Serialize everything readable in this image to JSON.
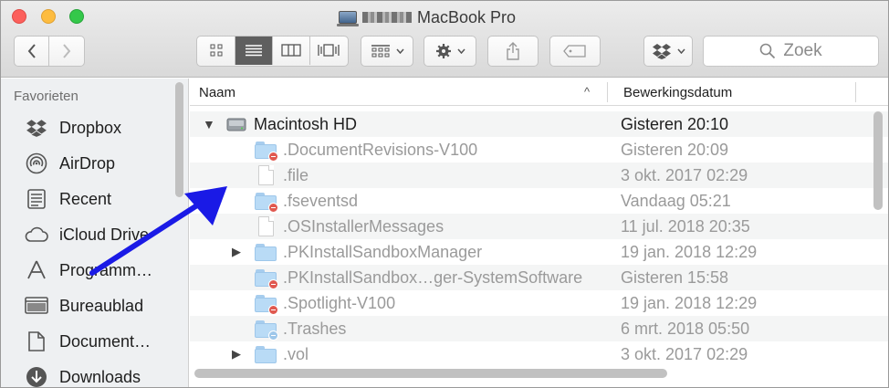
{
  "window": {
    "title": "MacBook Pro"
  },
  "toolbar": {
    "buttons": [
      "back-icon",
      "forward-icon",
      "icon-view-icon",
      "list-view-icon",
      "column-view-icon",
      "cover-flow-icon",
      "group-icon",
      "action-gear-icon",
      "share-icon",
      "tag-icon",
      "dropbox-icon"
    ],
    "active_view": "list",
    "search_placeholder": "Zoek"
  },
  "sidebar": {
    "header": "Favorieten",
    "items": [
      {
        "label": "Dropbox",
        "icon": "dropbox-icon"
      },
      {
        "label": "AirDrop",
        "icon": "airdrop-icon"
      },
      {
        "label": "Recent",
        "icon": "recent-icon"
      },
      {
        "label": "iCloud Drive",
        "icon": "cloud-icon"
      },
      {
        "label": "Programm…",
        "icon": "apps-icon"
      },
      {
        "label": "Bureaublad",
        "icon": "desktop-icon"
      },
      {
        "label": "Document…",
        "icon": "documents-icon"
      },
      {
        "label": "Downloads",
        "icon": "downloads-icon"
      }
    ]
  },
  "list": {
    "columns": {
      "name": "Naam",
      "date": "Bewerkingsdatum"
    },
    "rows": [
      {
        "name": "Macintosh HD",
        "date": "Gisteren 20:10",
        "kind": "disk",
        "disclosure": "▼"
      },
      {
        "name": ".DocumentRevisions-V100",
        "date": "Gisteren 20:09",
        "kind": "folder-locked"
      },
      {
        "name": ".file",
        "date": "3 okt. 2017 02:29",
        "kind": "file"
      },
      {
        "name": ".fseventsd",
        "date": "Vandaag 05:21",
        "kind": "folder-locked"
      },
      {
        "name": ".OSInstallerMessages",
        "date": "11 jul. 2018 20:35",
        "kind": "file"
      },
      {
        "name": ".PKInstallSandboxManager",
        "date": "19 jan. 2018 12:29",
        "kind": "folder",
        "disclosure": "▶"
      },
      {
        "name": ".PKInstallSandbox…ger-SystemSoftware",
        "date": "Gisteren 15:58",
        "kind": "folder-locked"
      },
      {
        "name": ".Spotlight-V100",
        "date": "19 jan. 2018 12:29",
        "kind": "folder-locked"
      },
      {
        "name": ".Trashes",
        "date": "6 mrt. 2018 05:50",
        "kind": "folder-dropbox"
      },
      {
        "name": ".vol",
        "date": "3 okt. 2017 02:29",
        "kind": "folder",
        "disclosure": "▶"
      }
    ]
  },
  "colors": {
    "annotation_arrow": "#1a1ae6",
    "folder": "#b9dbf6",
    "lock_badge": "#e0584f"
  }
}
